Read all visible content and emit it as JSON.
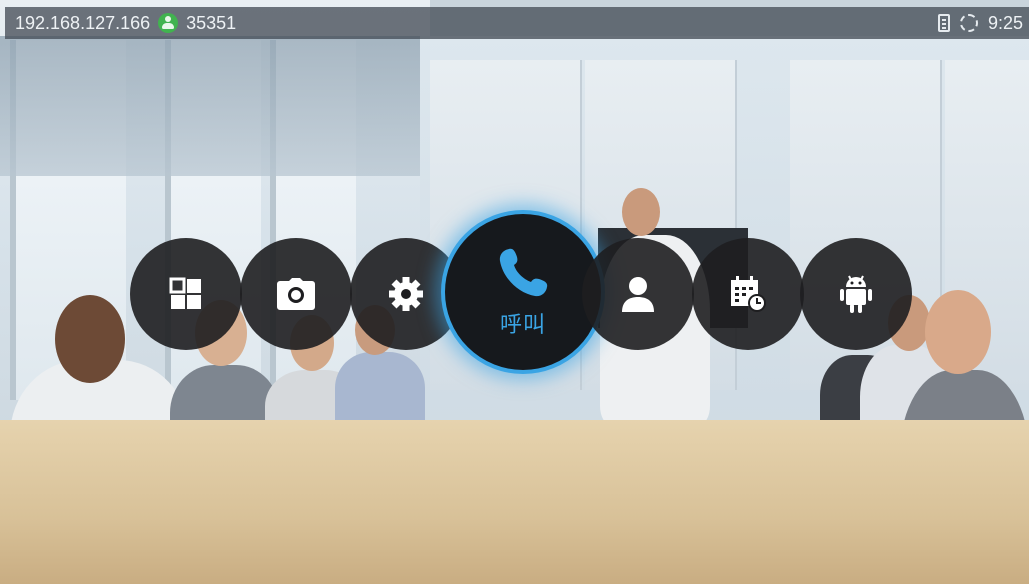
{
  "status_bar": {
    "ip_address": "192.168.127.166",
    "account_number": "35351",
    "time": "9:25"
  },
  "dock": {
    "apps": [
      {
        "icon": "dashboard-icon"
      },
      {
        "icon": "camera-icon"
      },
      {
        "icon": "settings-gear-icon"
      },
      {
        "icon": "phone-icon",
        "label": "呼叫",
        "selected": true
      },
      {
        "icon": "contacts-person-icon"
      },
      {
        "icon": "calendar-schedule-icon"
      },
      {
        "icon": "android-icon"
      }
    ]
  },
  "colors": {
    "accent": "#3aa4e4",
    "account_status": "#41b34f",
    "status_bar_bg": "#464e58",
    "app_bg": "#1e1e20"
  }
}
